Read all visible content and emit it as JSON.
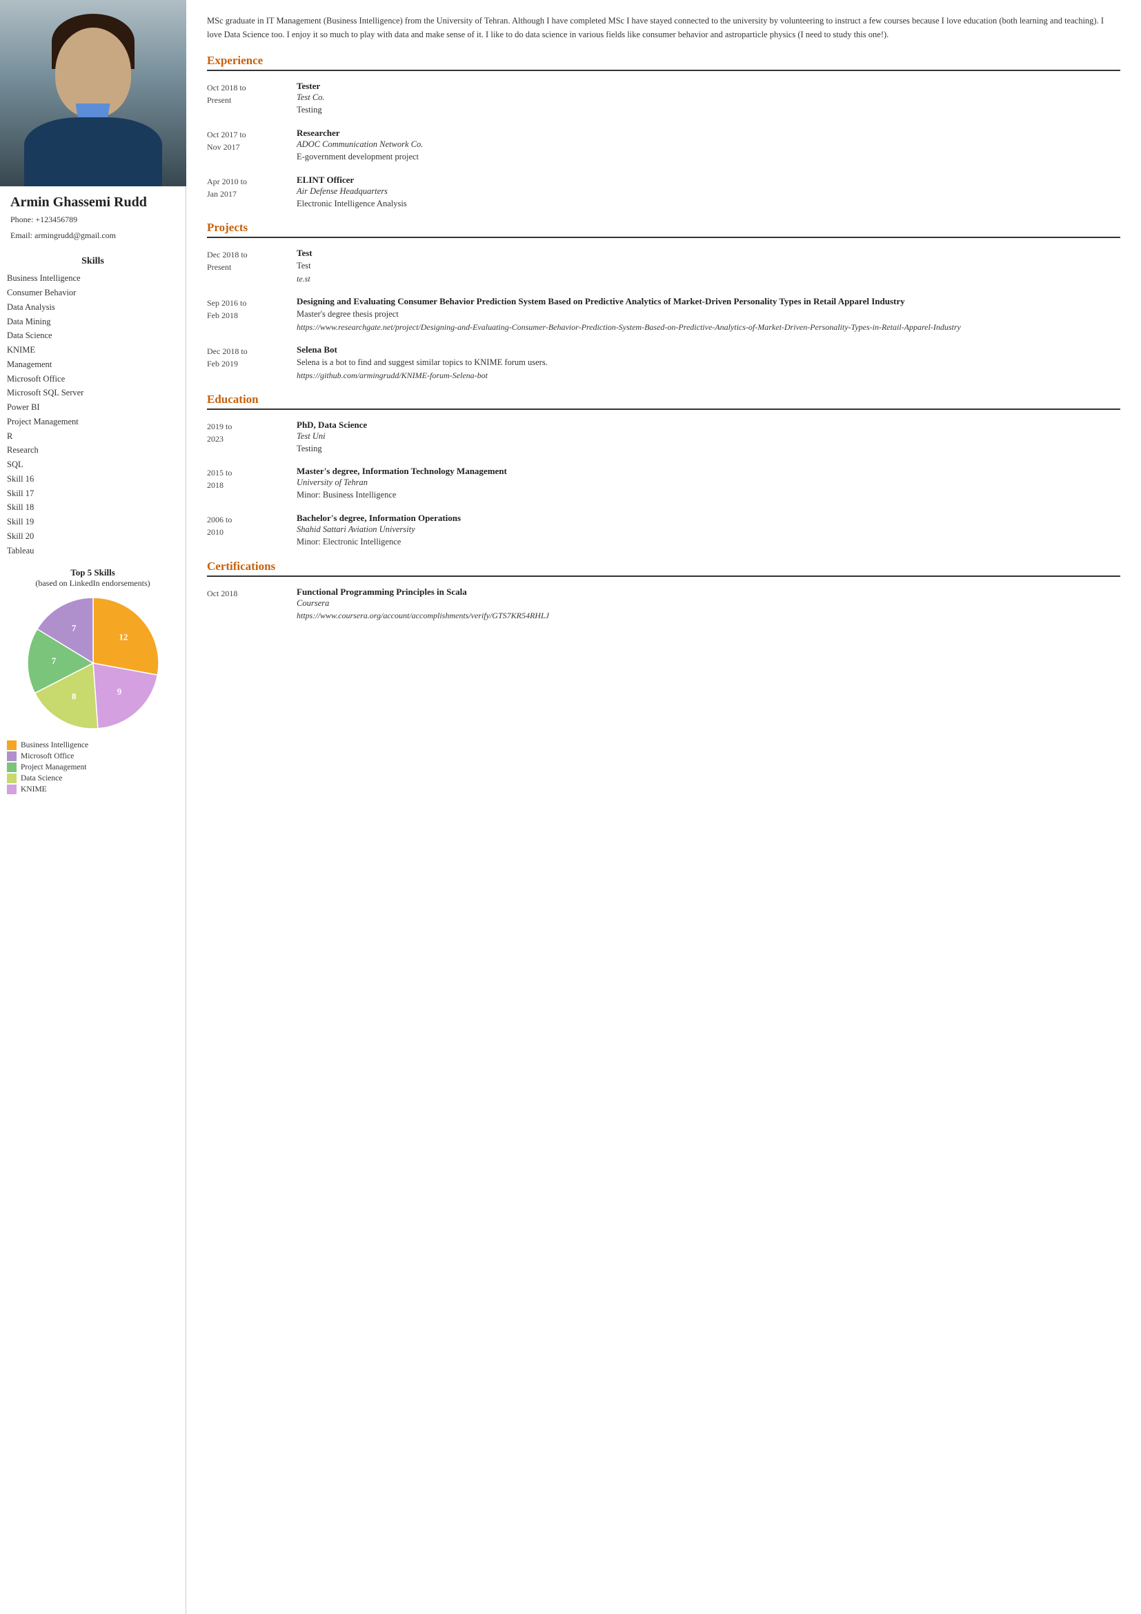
{
  "sidebar": {
    "name": "Armin Ghassemi Rudd",
    "phone": "Phone: +123456789",
    "email": "Email: armingrudd@gmail.com",
    "skills_title": "Skills",
    "skills": [
      "Business Intelligence",
      "Consumer Behavior",
      "Data Analysis",
      "Data Mining",
      "Data Science",
      "KNIME",
      "Management",
      "Microsoft Office",
      "Microsoft SQL Server",
      "Power BI",
      "Project Management",
      "R",
      "Research",
      "SQL",
      "Skill 16",
      "Skill 17",
      "Skill 18",
      "Skill 19",
      "Skill 20",
      "Tableau"
    ],
    "top5_title": "Top 5 Skills",
    "top5_subtitle": "(based on LinkedIn endorsements)",
    "chart": {
      "segments": [
        {
          "label": "Business Intelligence",
          "value": 12,
          "color": "#f5a623"
        },
        {
          "label": "KNIME",
          "value": 9,
          "color": "#d4a0e0"
        },
        {
          "label": "Data Science",
          "value": 8,
          "color": "#c8d96e"
        },
        {
          "label": "Project Management",
          "value": 7,
          "color": "#7bc47b"
        },
        {
          "label": "Microsoft Office",
          "value": 7,
          "color": "#b08fcd"
        }
      ]
    },
    "legend": [
      {
        "label": "Business Intelligence",
        "color": "#f5a623"
      },
      {
        "label": "Microsoft Office",
        "color": "#b08fcd"
      },
      {
        "label": "Project Management",
        "color": "#7bc47b"
      },
      {
        "label": "Data Science",
        "color": "#c8d96e"
      },
      {
        "label": "KNIME",
        "color": "#d4a0e0"
      }
    ]
  },
  "main": {
    "intro": "MSc graduate in IT Management (Business Intelligence) from the University of Tehran. Although I have completed MSc I have stayed connected to the university by volunteering to instruct a few courses because I love education (both learning and teaching).\nI love Data Science too. I enjoy it so much to play with data and make sense of it. I like to do data science in various fields like consumer behavior and astroparticle physics (I need to study this one!).",
    "sections": {
      "experience": {
        "title": "Experience",
        "entries": [
          {
            "date": "Oct 2018 to\nPresent",
            "title": "Tester",
            "org": "Test Co.",
            "desc": "Testing"
          },
          {
            "date": "Oct 2017 to\nNov 2017",
            "title": "Researcher",
            "org": "ADOC Communication Network Co.",
            "desc": "E-government development project"
          },
          {
            "date": "Apr 2010 to\nJan 2017",
            "title": "ELINT Officer",
            "org": "Air Defense Headquarters",
            "desc": "Electronic Intelligence Analysis"
          }
        ]
      },
      "projects": {
        "title": "Projects",
        "entries": [
          {
            "date": "Dec 2018 to\nPresent",
            "title": "Test",
            "desc": "Test",
            "url": "te.st"
          },
          {
            "date": "Sep 2016 to\nFeb 2018",
            "title": "Designing and Evaluating Consumer Behavior Prediction System Based on Predictive Analytics of Market-Driven Personality Types in Retail Apparel Industry",
            "desc": "Master's degree thesis project",
            "url": "https://www.researchgate.net/project/Designing-and-Evaluating-Consumer-Behavior-Prediction-System-Based-on-Predictive-Analytics-of-Market-Driven-Personality-Types-in-Retail-Apparel-Industry"
          },
          {
            "date": "Dec 2018 to\nFeb 2019",
            "title": "Selena Bot",
            "desc": "Selena is a bot to find and suggest similar topics to KNIME forum users.",
            "url": "https://github.com/armingrudd/KNIME-forum-Selena-bot"
          }
        ]
      },
      "education": {
        "title": "Education",
        "entries": [
          {
            "date": "2019 to\n2023",
            "title": "PhD, Data Science",
            "org": "Test Uni",
            "desc": "Testing"
          },
          {
            "date": "2015 to\n2018",
            "title": "Master's degree, Information Technology Management",
            "org": "University of Tehran",
            "desc": "Minor: Business Intelligence"
          },
          {
            "date": "2006 to\n2010",
            "title": "Bachelor's degree, Information Operations",
            "org": "Shahid Sattari Aviation University",
            "desc": "Minor: Electronic Intelligence"
          }
        ]
      },
      "certifications": {
        "title": "Certifications",
        "entries": [
          {
            "date": "Oct 2018",
            "title": "Functional Programming Principles in Scala",
            "org": "Coursera",
            "url": "https://www.coursera.org/account/accomplishments/verify/GTS7KR54RHLJ"
          }
        ]
      }
    }
  }
}
